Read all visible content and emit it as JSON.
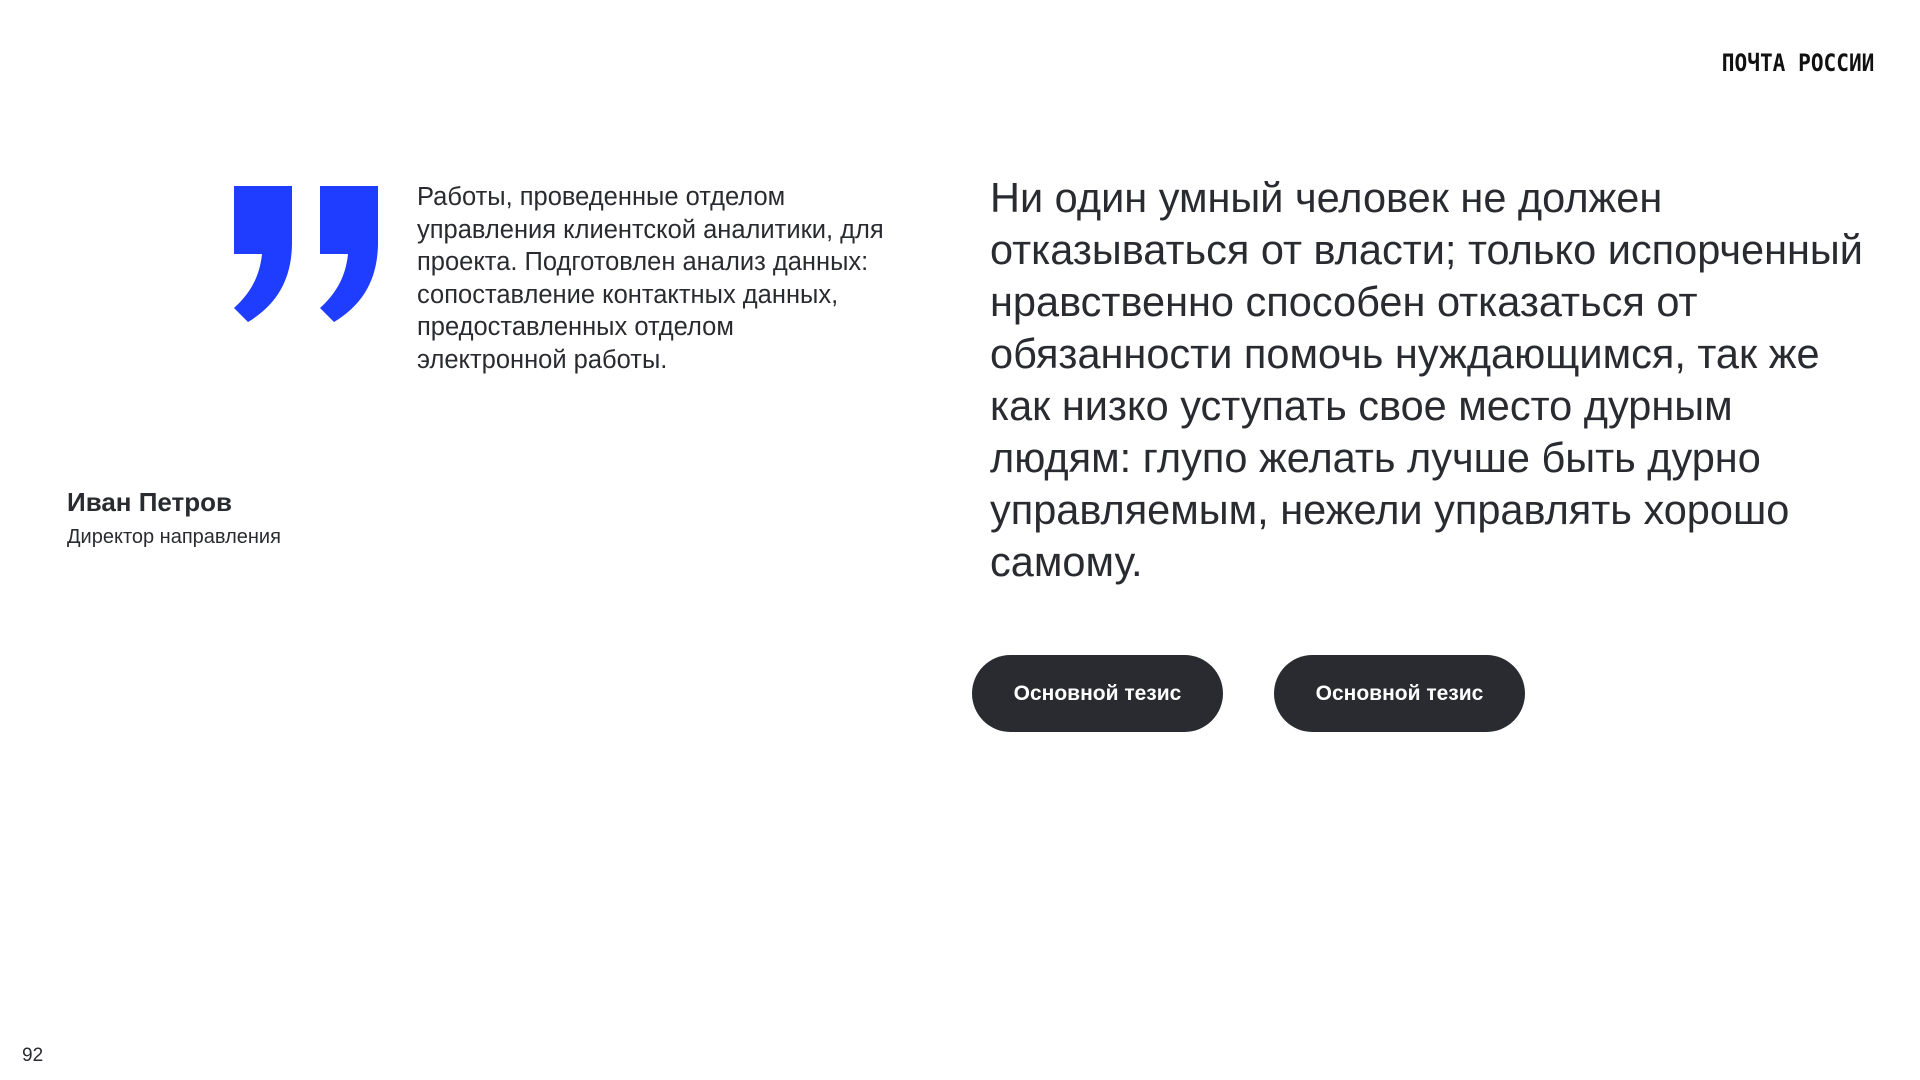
{
  "header": {
    "logo_text": "ПОЧТА РОССИИ"
  },
  "quote_block": {
    "icon": "closing-quote-icon",
    "accent_color": "#1f3dff",
    "text": "Работы, проведенные отделом управления клиентской аналитики, для проекта. Подготовлен анализ данных: сопоставление контактных данных, предоставленных отделом электронной работы."
  },
  "author": {
    "name": "Иван Петров",
    "role": "Директор направления"
  },
  "main_quote": {
    "text": "Ни один умный человек не должен отказываться от власти; только испорченный нравственно способен отказаться от обязанности помочь нуждающимся, так же как низко уступать свое место дурным людям: глупо желать лучше быть дурно управляемым, нежели управлять хорошо самому."
  },
  "buttons": [
    {
      "label": "Основной тезис"
    },
    {
      "label": "Основной тезис"
    }
  ],
  "footer": {
    "page_number": "92"
  },
  "colors": {
    "text": "#2a2b30",
    "button_bg": "#2a2b30",
    "button_text": "#ffffff",
    "accent": "#1f3dff"
  }
}
